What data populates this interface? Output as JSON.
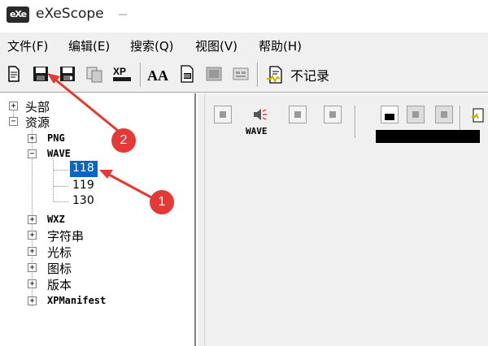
{
  "window": {
    "title": "eXeScope",
    "logo_text": "eXe"
  },
  "menu": {
    "items": [
      {
        "label": "文件(F)"
      },
      {
        "label": "编辑(E)"
      },
      {
        "label": "搜索(Q)"
      },
      {
        "label": "视图(V)"
      },
      {
        "label": "帮助(H)"
      }
    ]
  },
  "toolbar": {
    "label": "不记录",
    "icons": [
      "open-file-icon",
      "save-icon",
      "save-as-icon",
      "copy-icon",
      "xp-icon",
      "font-icon",
      "bitmap-icon",
      "image-icon",
      "dialog-icon",
      "hook-icon"
    ],
    "xp_text": "XP",
    "font_text": "AA"
  },
  "tree": {
    "header": "头部",
    "resources": "资源",
    "png": "PNG",
    "wave": "WAVE",
    "wave_children": [
      "118",
      "119",
      "130"
    ],
    "wxz": "WXZ",
    "strings": "字符串",
    "cursor": "光标",
    "icon": "图标",
    "version": "版本",
    "manifest": "XPManifest",
    "selected": "118"
  },
  "player": {
    "wave_label": "WAVE"
  },
  "annotations": {
    "badge1": "1",
    "badge2": "2",
    "color": "#e53935"
  }
}
